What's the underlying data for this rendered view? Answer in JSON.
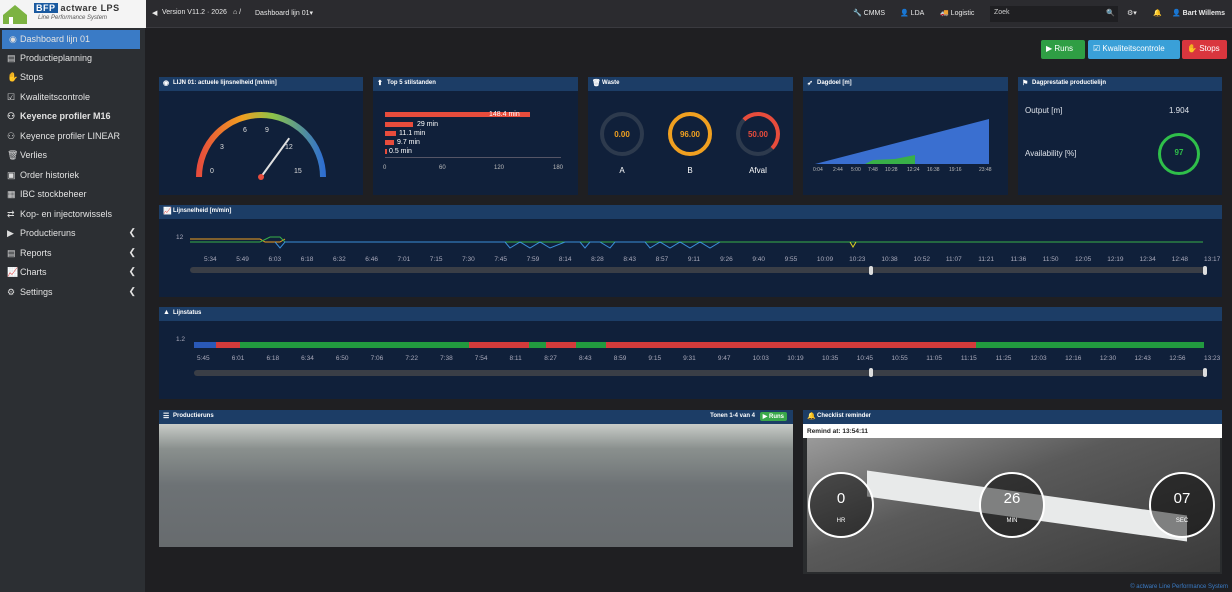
{
  "header": {
    "version": "Version V11.2 · 2026",
    "breadcrumb": "Dashboard lijn 01",
    "cmms": "CMMS",
    "lda": "LDA",
    "logistic": "Logistic",
    "search_placeholder": "Zoek",
    "user": "Bart Willems",
    "logo_brand": "BFP",
    "logo_name": "actware",
    "logo_suffix": "LPS",
    "logo_tagline": "Line Performance System"
  },
  "sidebar": [
    {
      "label": "Dashboard lijn 01",
      "icon": "dashboard-icon"
    },
    {
      "label": "Productieplanning",
      "icon": "planning-icon"
    },
    {
      "label": "Stops",
      "icon": "stop-icon"
    },
    {
      "label": "Kwaliteitscontrole",
      "icon": "check-icon"
    },
    {
      "label": "Keyence profiler M16",
      "icon": "profiler-icon"
    },
    {
      "label": "Keyence profiler LINEAR",
      "icon": "profiler-icon"
    },
    {
      "label": "Verlies",
      "icon": "loss-icon"
    },
    {
      "label": "Order historiek",
      "icon": "history-icon"
    },
    {
      "label": "IBC stockbeheer",
      "icon": "stock-icon"
    },
    {
      "label": "Kop- en injectorwissels",
      "icon": "swap-icon"
    },
    {
      "label": "Productieruns",
      "icon": "runs-icon"
    },
    {
      "label": "Reports",
      "icon": "reports-icon"
    },
    {
      "label": "Charts",
      "icon": "charts-icon"
    },
    {
      "label": "Settings",
      "icon": "settings-icon"
    }
  ],
  "actions": {
    "runs": "Runs",
    "quality": "Kwaliteitscontrole",
    "stops": "Stops"
  },
  "panels": {
    "speed": "LIJN 01: actuele lijnsnelheid [m/min]",
    "top5": "Top 5 stilstanden",
    "waste": "Waste",
    "target": "Dagdoel [m]",
    "daily": "Dagprestatie productielijn",
    "lineSpeed": "Lijnsnelheid [m/min]",
    "lineStatus": "Lijnstatus",
    "runs": "Productieruns",
    "runsCount": "Tonen 1-4 van 4",
    "runsBadge": "Runs",
    "checklist": "Checklist reminder"
  },
  "gauge": {
    "value": 10.5,
    "min": 0,
    "max": 15,
    "ticks": [
      "0",
      "3",
      "6",
      "9",
      "12",
      "15"
    ]
  },
  "top5": {
    "type": "bar",
    "values": [
      148.4,
      29,
      11.1,
      9.7,
      0.5
    ],
    "labels": [
      "148.4 min",
      "29 min",
      "11.1 min",
      "9.7 min",
      "0.5 min"
    ],
    "xticks": [
      "0",
      "60",
      "120",
      "180"
    ],
    "xlim": [
      0,
      180
    ]
  },
  "waste": [
    {
      "value": "0.00",
      "label": "A",
      "color": "#f0a020",
      "pct": 0
    },
    {
      "value": "96.00",
      "label": "B",
      "color": "#f0a020",
      "pct": 0.96
    },
    {
      "value": "50.00",
      "label": "Afval",
      "color": "#e74c3c",
      "pct": 0.5
    }
  ],
  "target_axis": [
    "0:04",
    "2:44",
    "5:00",
    "7:48",
    "10:28",
    "12:24",
    "16:38",
    "19:16",
    "23:48"
  ],
  "daily": {
    "outputLabel": "Output [m]",
    "output": "1.904",
    "availLabel": "Availability [%]",
    "avail": "97"
  },
  "speed_axis": {
    "ymax": "12",
    "ticks": [
      "5:34",
      "5:49",
      "6:03",
      "6:18",
      "6:32",
      "6:46",
      "7:01",
      "7:15",
      "7:30",
      "7:45",
      "7:59",
      "8:14",
      "8:28",
      "8:43",
      "8:57",
      "9:11",
      "9:26",
      "9:40",
      "9:55",
      "10:09",
      "10:23",
      "10:38",
      "10:52",
      "11:07",
      "11:21",
      "11:36",
      "11:50",
      "12:05",
      "12:19",
      "12:34",
      "12:48",
      "13:17"
    ]
  },
  "status_axis": {
    "ymax": "1.2",
    "ticks": [
      "5:45",
      "6:01",
      "6:18",
      "6:34",
      "6:50",
      "7:06",
      "7:22",
      "7:38",
      "7:54",
      "8:11",
      "8:27",
      "8:43",
      "8:59",
      "9:15",
      "9:31",
      "9:47",
      "10:03",
      "10:19",
      "10:35",
      "10:45",
      "10:55",
      "11:05",
      "11:15",
      "11:25",
      "12:03",
      "12:16",
      "12:30",
      "12:43",
      "12:56",
      "13:23"
    ]
  },
  "checklist": {
    "remind": "Remind at: 13:54:11",
    "hr": "0",
    "min": "26",
    "sec": "07",
    "hrLabel": "HR",
    "minLabel": "MIN",
    "secLabel": "SEC"
  },
  "footer": "© actware Line Performance System"
}
